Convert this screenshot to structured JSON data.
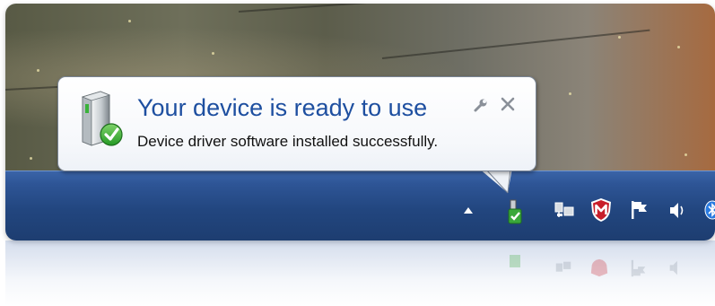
{
  "balloon": {
    "title": "Your device is ready to use",
    "message": "Device driver software installed successfully.",
    "options_icon": "wrench-icon",
    "close_icon": "close-icon",
    "device_icon": "device-drive-with-checkmark-icon"
  },
  "taskbar": {
    "tray_icons": [
      "show-hidden-icons-arrow",
      "device-installed-icon",
      "network-icon",
      "mcafee-shield-icon",
      "action-center-flag-icon",
      "volume-icon",
      "bluetooth-icon"
    ]
  },
  "colors": {
    "title": "#1e4fa0",
    "taskbar": "#22467f",
    "check_green": "#3aa83a",
    "mcafee_red": "#c81e2a"
  }
}
